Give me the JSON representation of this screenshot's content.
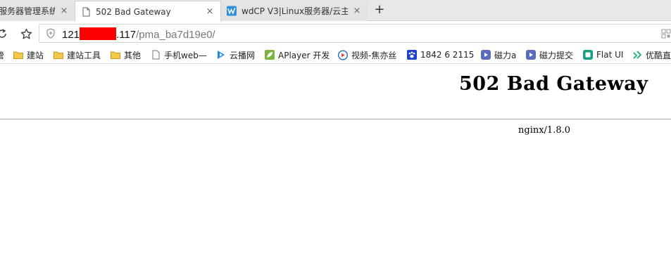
{
  "tabs": [
    {
      "title": "服务器管理系统",
      "close": "×",
      "active": false
    },
    {
      "title": "502 Bad Gateway",
      "close": "×",
      "active": true
    },
    {
      "title": "wdCP V3|Linux服务器/云主",
      "close": "×",
      "active": false
    }
  ],
  "new_tab": "+",
  "address": {
    "url_prefix": "121",
    "url_suffix": ".117",
    "url_path": "/pma_ba7d19e0/"
  },
  "bookmarks": [
    {
      "label": "管",
      "icon": "folder-icon"
    },
    {
      "label": "建站",
      "icon": "folder-icon"
    },
    {
      "label": "建站工具",
      "icon": "folder-icon"
    },
    {
      "label": "其他",
      "icon": "folder-icon"
    },
    {
      "label": "手机web—",
      "icon": "page-icon"
    },
    {
      "label": "云播网",
      "icon": "play-icon"
    },
    {
      "label": "APlayer 开发",
      "icon": "leaf-icon"
    },
    {
      "label": "视频-焦亦丝",
      "icon": "video-icon"
    },
    {
      "label": "1842 6 2115",
      "icon": "paw-icon"
    },
    {
      "label": "磁力a",
      "icon": "magnet-icon"
    },
    {
      "label": "磁力提交",
      "icon": "magnet-icon"
    },
    {
      "label": "Flat UI",
      "icon": "flat-ui-icon"
    },
    {
      "label": "优酷直",
      "icon": "youku-icon"
    }
  ],
  "page": {
    "heading": "502 Bad Gateway",
    "server": "nginx/1.8.0"
  },
  "colors": {
    "redaction": "#ff0000",
    "tab_strip": "#e8e8e8",
    "folder": "#e8b93a",
    "play": "#1e88e5",
    "leaf": "#7cb342",
    "video": "#1565c0",
    "paw": "#1e3fd0",
    "magnet": "#5c6bc0",
    "flat_ui": "#16a085",
    "youku": "#2bb673"
  }
}
